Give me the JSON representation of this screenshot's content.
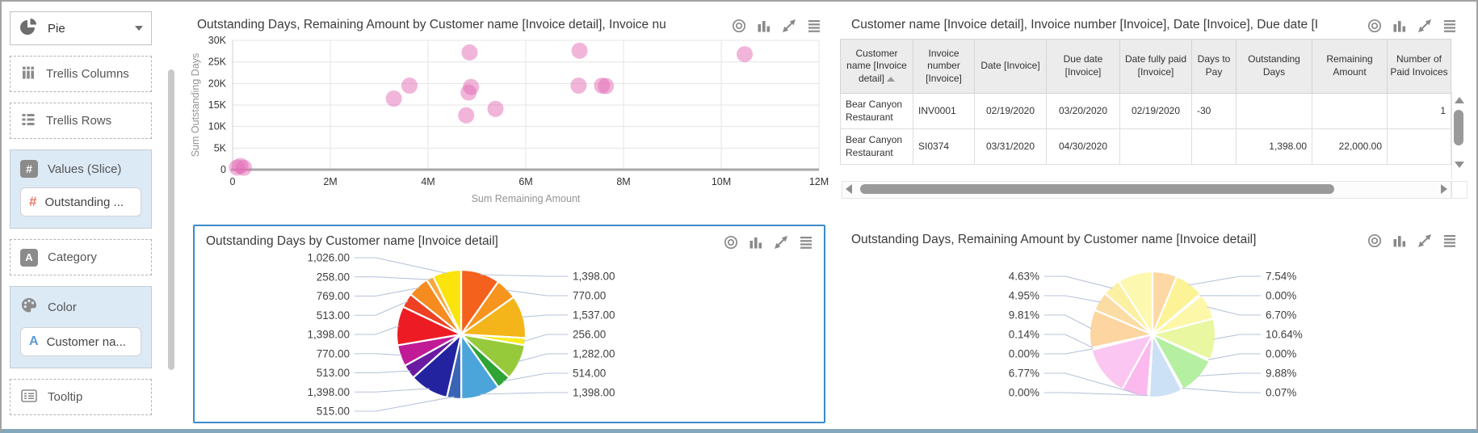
{
  "window": {
    "accent_blue": "#3d8ac9"
  },
  "sidebar": {
    "chart_type_selector": {
      "value": "Pie"
    },
    "items": [
      {
        "label": "Trellis Columns"
      },
      {
        "label": "Trellis Rows"
      },
      {
        "label": "Values (Slice)",
        "chip": "Outstanding ..."
      },
      {
        "label": "Category"
      },
      {
        "label": "Color",
        "chip": "Customer na..."
      },
      {
        "label": "Tooltip"
      }
    ]
  },
  "panel_toolbar_icons": [
    "target-icon",
    "bar-chart-icon",
    "expand-icon",
    "menu-icon"
  ],
  "chart_data": [
    {
      "type": "scatter",
      "title": "Outstanding Days, Remaining Amount by Customer name [Invoice detail], Invoice nu",
      "xlabel": "Sum Remaining Amount",
      "ylabel": "Sum Outstanding Days",
      "xlim": [
        0,
        12000000
      ],
      "ylim": [
        0,
        30000
      ],
      "grid": true,
      "x_ticks": [
        {
          "label": "0",
          "value": 0
        },
        {
          "label": "2M",
          "value": 2000000
        },
        {
          "label": "4M",
          "value": 4000000
        },
        {
          "label": "6M",
          "value": 6000000
        },
        {
          "label": "8M",
          "value": 8000000
        },
        {
          "label": "10M",
          "value": 10000000
        },
        {
          "label": "12M",
          "value": 12000000
        }
      ],
      "y_ticks": [
        {
          "label": "0",
          "value": 0
        },
        {
          "label": "5K",
          "value": 5000
        },
        {
          "label": "10K",
          "value": 10000
        },
        {
          "label": "15K",
          "value": 15000
        },
        {
          "label": "20K",
          "value": 20000
        },
        {
          "label": "25K",
          "value": 25000
        },
        {
          "label": "30K",
          "value": 30000
        }
      ],
      "point_color": "#e36bb5",
      "points": [
        [
          90000,
          500
        ],
        [
          160000,
          850
        ],
        [
          230000,
          450
        ],
        [
          3300000,
          16500
        ],
        [
          3620000,
          19500
        ],
        [
          4850000,
          27200
        ],
        [
          4880000,
          19200
        ],
        [
          4830000,
          17900
        ],
        [
          4780000,
          12600
        ],
        [
          5380000,
          14100
        ],
        [
          7100000,
          27600
        ],
        [
          7080000,
          19500
        ],
        [
          7560000,
          19500
        ],
        [
          7640000,
          19400
        ],
        [
          10480000,
          26800
        ]
      ]
    },
    {
      "type": "table",
      "title": "Customer name [Invoice detail], Invoice number [Invoice], Date [Invoice], Due date [I",
      "columns": [
        {
          "label": "Customer name [Invoice detail]",
          "sort": "asc",
          "width": 90,
          "align": "left"
        },
        {
          "label": "Invoice number [Invoice]",
          "width": 76,
          "align": "left"
        },
        {
          "label": "Date [Invoice]",
          "width": 89,
          "align": "center"
        },
        {
          "label": "Due date [Invoice]",
          "width": 91,
          "align": "center"
        },
        {
          "label": "Date fully paid [Invoice]",
          "width": 89,
          "align": "center"
        },
        {
          "label": "Days to Pay",
          "width": 55,
          "align": "left"
        },
        {
          "label": "Outstanding Days",
          "width": 94,
          "align": "right"
        },
        {
          "label": "Remaining Amount",
          "width": 93,
          "align": "right"
        },
        {
          "label": "Number of Paid Invoices",
          "width": 79,
          "align": "right"
        }
      ],
      "rows": [
        [
          "Bear Canyon Restaurant",
          "INV0001",
          "02/19/2020",
          "03/20/2020",
          "02/19/2020",
          "-30",
          "",
          "",
          "1"
        ],
        [
          "Bear Canyon Restaurant",
          "SI0374",
          "03/31/2020",
          "04/30/2020",
          "",
          "",
          "1,398.00",
          "22,000.00",
          ""
        ]
      ]
    },
    {
      "type": "pie",
      "title": "Outstanding Days by Customer name [Invoice detail]",
      "selected": true,
      "slices": [
        {
          "label": "1,398.00",
          "value": 1398,
          "color": "#f4611d"
        },
        {
          "label": "770.00",
          "value": 770,
          "color": "#f7941e"
        },
        {
          "label": "1,537.00",
          "value": 1537,
          "color": "#f3b51a"
        },
        {
          "label": "256.00",
          "value": 256,
          "color": "#f9ec1f"
        },
        {
          "label": "1,282.00",
          "value": 1282,
          "color": "#97ca3b"
        },
        {
          "label": "514.00",
          "value": 514,
          "color": "#2fa434"
        },
        {
          "label": "1,398.00",
          "value": 1398,
          "color": "#4ba5da"
        },
        {
          "label": "515.00",
          "value": 515,
          "color": "#3a64b5"
        },
        {
          "label": "1,398.00",
          "value": 1398,
          "color": "#2323a0"
        },
        {
          "label": "513.00",
          "value": 513,
          "color": "#6a1ba2"
        },
        {
          "label": "770.00",
          "value": 770,
          "color": "#c01a96"
        },
        {
          "label": "1,398.00",
          "value": 1398,
          "color": "#ed1c24"
        },
        {
          "label": "513.00",
          "value": 513,
          "color": "#ee4023"
        },
        {
          "label": "769.00",
          "value": 769,
          "color": "#f68b1f"
        },
        {
          "label": "258.00",
          "value": 258,
          "color": "#faa73c"
        },
        {
          "label": "1,026.00",
          "value": 1026,
          "color": "#fbe40e"
        }
      ]
    },
    {
      "type": "pie",
      "title": "Outstanding Days, Remaining Amount by Customer name [Invoice detail]",
      "selected": false,
      "slices": [
        {
          "label": "",
          "value": 6.3,
          "color": "#fed8a4"
        },
        {
          "label": "7.54%",
          "value": 7.54,
          "color": "#fcf397"
        },
        {
          "label": "0.00%",
          "value": 0.4,
          "color": "#ffeab0"
        },
        {
          "label": "6.70%",
          "value": 6.7,
          "color": "#fdf7a9"
        },
        {
          "label": "10.64%",
          "value": 10.64,
          "color": "#e9f7a0"
        },
        {
          "label": "0.00%",
          "value": 0.4,
          "color": "#d8f2a8"
        },
        {
          "label": "9.88%",
          "value": 9.88,
          "color": "#b5efa2"
        },
        {
          "label": "0.07%",
          "value": 0.4,
          "color": "#d6e9f8"
        },
        {
          "label": "",
          "value": 8.6,
          "color": "#cde1f6"
        },
        {
          "label": "0.00%",
          "value": 0.4,
          "color": "#fbd0f3"
        },
        {
          "label": "6.77%",
          "value": 6.77,
          "color": "#fcb9ee"
        },
        {
          "label": "",
          "value": 13.0,
          "color": "#fbc6f1"
        },
        {
          "label": "0.00%",
          "value": 0.4,
          "color": "#fbd5f0"
        },
        {
          "label": "0.14%",
          "value": 0.14,
          "color": "#f6c6e0"
        },
        {
          "label": "9.81%",
          "value": 9.81,
          "color": "#fcd5a0"
        },
        {
          "label": "4.95%",
          "value": 4.95,
          "color": "#fbdca4"
        },
        {
          "label": "4.63%",
          "value": 4.63,
          "color": "#fcf0a2"
        },
        {
          "label": "",
          "value": 9.04,
          "color": "#fdf8b0"
        }
      ]
    }
  ]
}
